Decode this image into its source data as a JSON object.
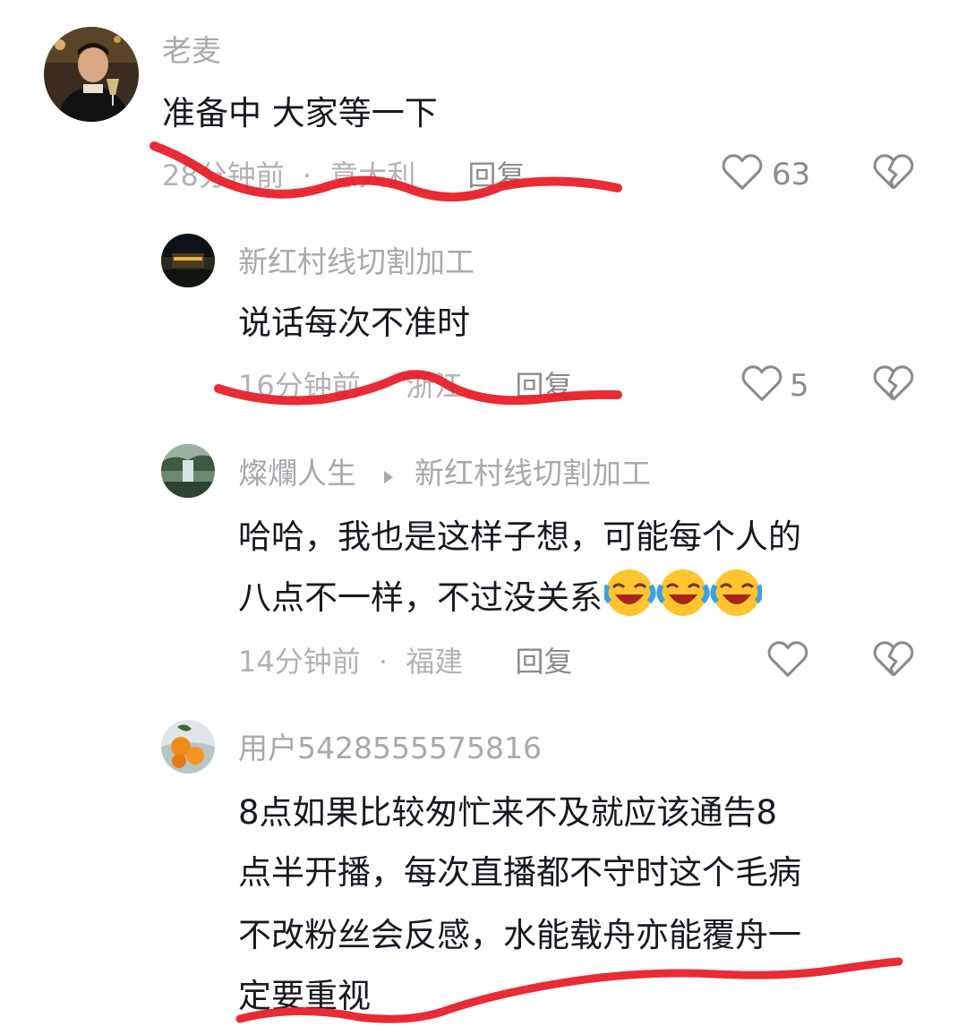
{
  "comments": [
    {
      "name": "老麦",
      "text": "准备中 大家等一下",
      "time": "28分钟前",
      "location": "意大利",
      "reply_label": "回复",
      "like_count": "63",
      "icons": {
        "like": "heart-outline-icon",
        "dislike": "broken-heart-icon"
      }
    },
    {
      "name": "新红村线切割加工",
      "text": "说话每次不准时",
      "time": "16分钟前",
      "location": "浙江",
      "reply_label": "回复",
      "like_count": "5"
    },
    {
      "name": "燦爛人生",
      "reply_to": "新红村线切割加工",
      "text_lines": [
        "哈哈，我也是这样子想，可能每个人的",
        "八点不一样，不过没关系"
      ],
      "emoji": "laugh-cry-emoji",
      "time": "14分钟前",
      "location": "福建",
      "reply_label": "回复"
    },
    {
      "name": "用户5428555575816",
      "text_lines": [
        "8点如果比较匆忙来不及就应该通告8",
        "点半开播，每次直播都不守时这个毛病",
        "不改粉丝会反感，水能载舟亦能覆舟一",
        "定要重视"
      ]
    }
  ],
  "separator": "·",
  "annotation_color": "#e8202a"
}
